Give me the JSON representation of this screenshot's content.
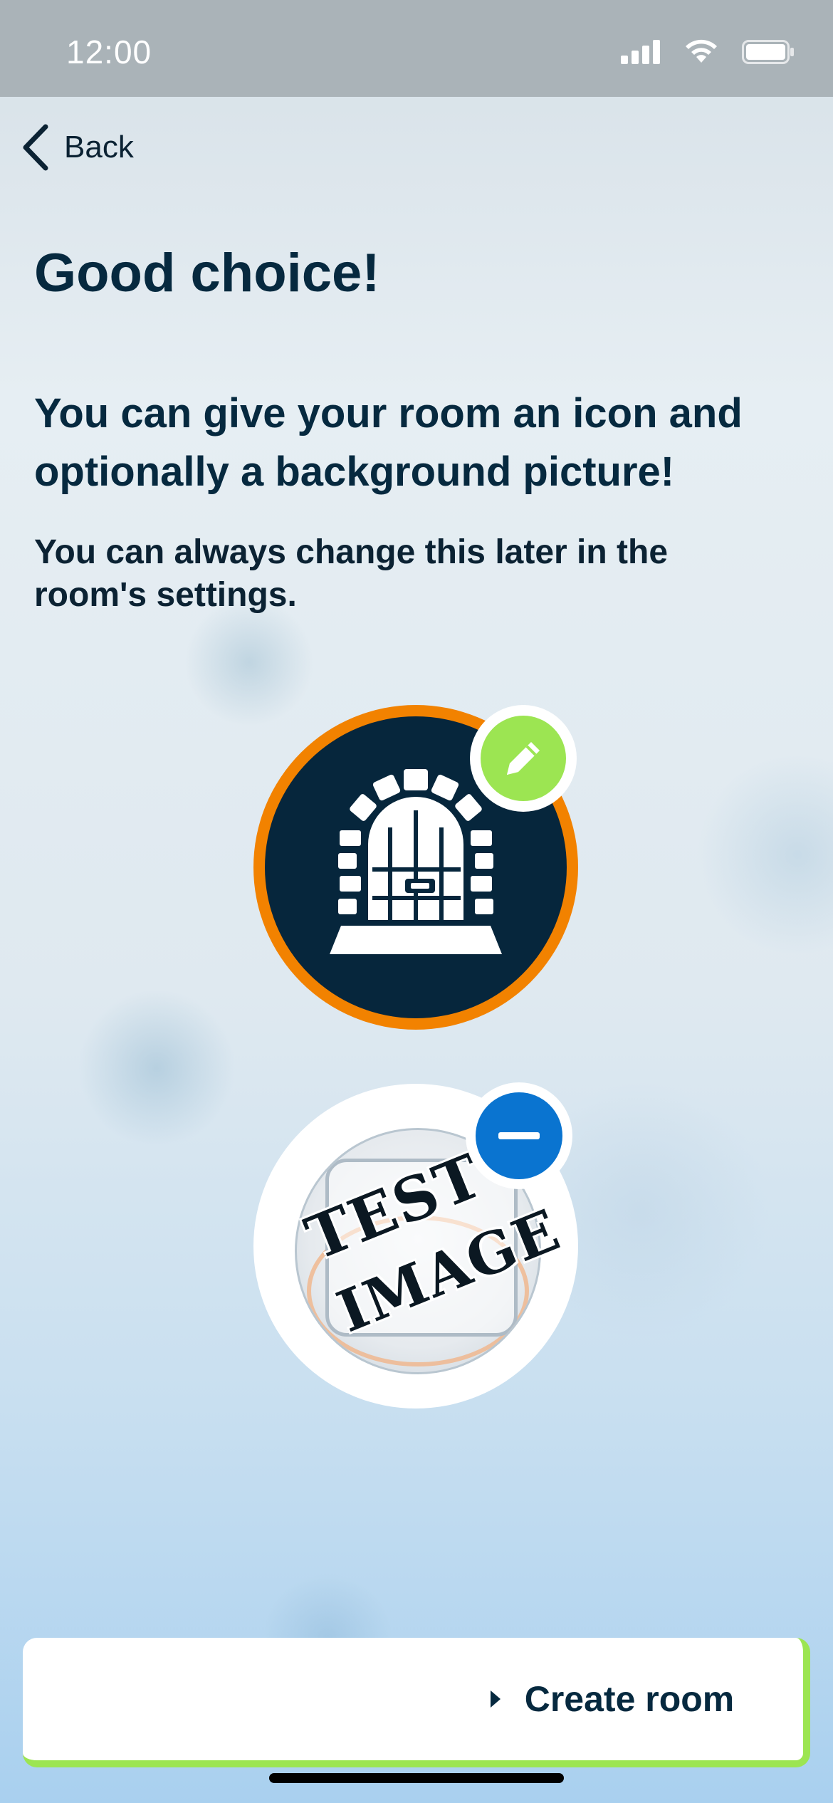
{
  "status_bar": {
    "time": "12:00",
    "icons": [
      "signal-icon",
      "wifi-icon",
      "battery-icon"
    ]
  },
  "nav": {
    "back_label": "Back",
    "back_icon": "chevron-left-icon"
  },
  "content": {
    "heading": "Good choice!",
    "subheading": "You can give your room an icon and optionally a background picture!",
    "hint": "You can always change this later in the room's settings."
  },
  "room_icon": {
    "icon": "door-icon",
    "ring_color": "#f28200",
    "fill_color": "#06263c",
    "edit_icon": "pencil-icon",
    "edit_color": "#9ce552"
  },
  "background_picture": {
    "overlay_text_line1": "TEST",
    "overlay_text_line2": "IMAGE",
    "remove_icon": "minus-icon",
    "remove_color": "#0a74d0"
  },
  "footer": {
    "create_button_label": "Create room",
    "create_button_icon": "play-icon",
    "accent_color": "#9ce552"
  }
}
